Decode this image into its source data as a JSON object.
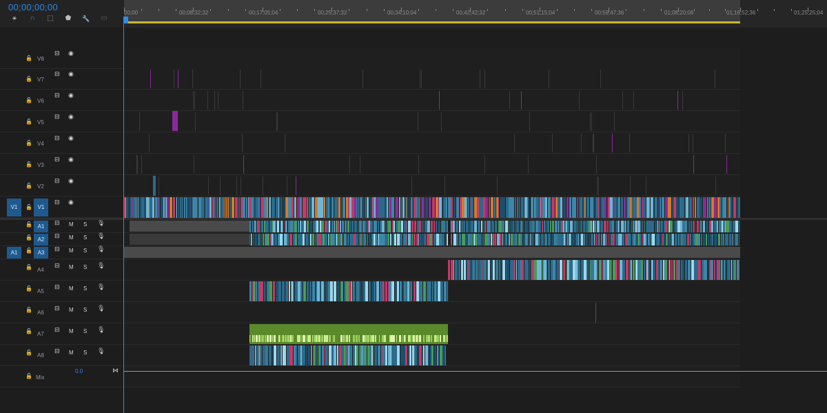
{
  "timecode": "00;00;00;00",
  "ruler": {
    "labels": [
      "00;00",
      "00;08;32;32",
      "00;17;05;04",
      "00;25;37;32",
      "00;34;10;04",
      "00;42;42;32",
      "00;51;15;04",
      "00;59;47;36",
      "01;08;20;08",
      "01;16;52;36",
      "01;25;25;04"
    ]
  },
  "tools": [
    {
      "icon": "snap-icon",
      "glyph": "⚹"
    },
    {
      "icon": "magnet-icon",
      "glyph": "∩"
    },
    {
      "icon": "linked-selection-icon",
      "glyph": "⬚"
    },
    {
      "icon": "marker-icon",
      "glyph": "⬟"
    },
    {
      "icon": "wrench-icon",
      "glyph": "🔧"
    },
    {
      "icon": "captions-icon",
      "glyph": "▭"
    }
  ],
  "video_tracks": [
    {
      "name": "V8"
    },
    {
      "name": "V7"
    },
    {
      "name": "V6"
    },
    {
      "name": "V5"
    },
    {
      "name": "V4"
    },
    {
      "name": "V3"
    },
    {
      "name": "V2"
    },
    {
      "name": "V1",
      "source": "V1"
    }
  ],
  "audio_tracks": [
    {
      "name": "A1"
    },
    {
      "name": "A2"
    },
    {
      "name": "A3",
      "source": "A1"
    },
    {
      "name": "A4"
    },
    {
      "name": "A5"
    },
    {
      "name": "A6"
    },
    {
      "name": "A7"
    },
    {
      "name": "A8"
    }
  ],
  "mix": {
    "label": "Mix",
    "value": "0.0"
  },
  "audio_buttons": {
    "mute": "M",
    "solo": "S"
  },
  "colors": {
    "accent": "#2d8ceb",
    "clip_blue": "#2b6a8a",
    "clip_green": "#5a8a2a",
    "clip_purple": "#9a3aa0"
  }
}
